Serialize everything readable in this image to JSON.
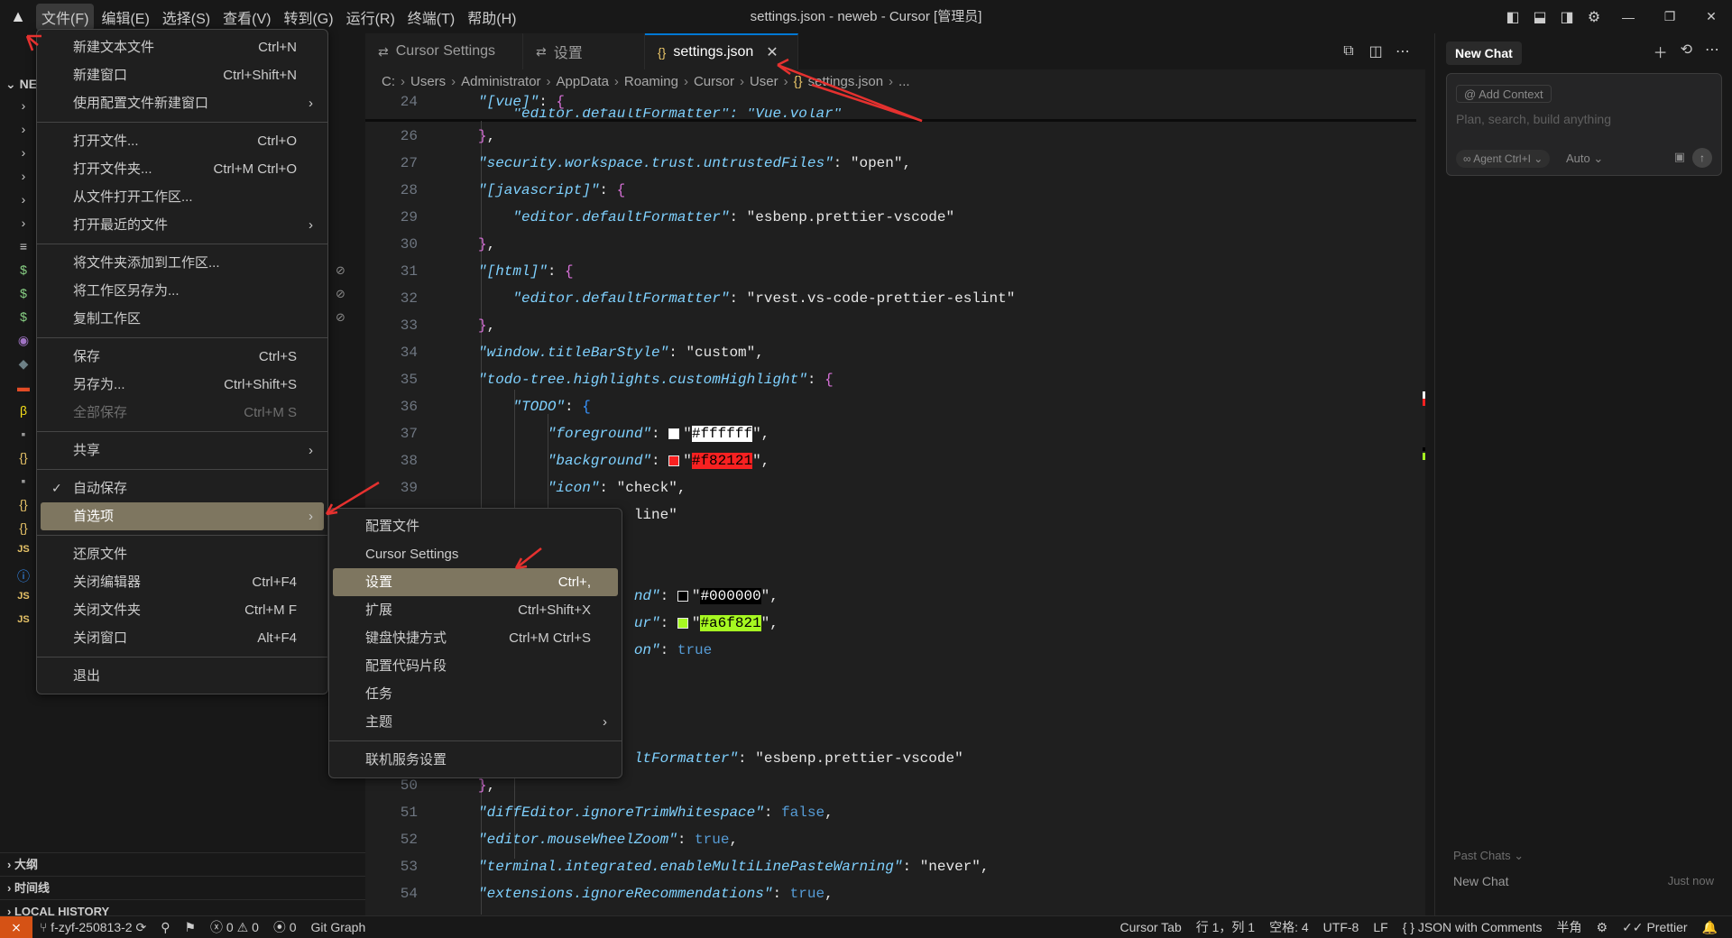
{
  "window_title": "settings.json - neweb - Cursor [管理员]",
  "menubar": [
    "文件(F)",
    "编辑(E)",
    "选择(S)",
    "查看(V)",
    "转到(G)",
    "运行(R)",
    "终端(T)",
    "帮助(H)"
  ],
  "sidebar": {
    "header": "NE",
    "bottom": [
      "大纲",
      "时间线",
      "LOCAL HISTORY"
    ]
  },
  "tabs": [
    {
      "label": "Cursor Settings",
      "icon": "settings-sliders-icon"
    },
    {
      "label": "设置",
      "icon": "settings-sliders-icon"
    },
    {
      "label": "settings.json",
      "icon": "json-braces-icon"
    }
  ],
  "breadcrumb": [
    "C:",
    "Users",
    "Administrator",
    "AppData",
    "Roaming",
    "Cursor",
    "User",
    "settings.json",
    "..."
  ],
  "file_menu": [
    {
      "label": "新建文本文件",
      "shortcut": "Ctrl+N"
    },
    {
      "label": "新建窗口",
      "shortcut": "Ctrl+Shift+N"
    },
    {
      "label": "使用配置文件新建窗口",
      "submenu": true
    },
    {
      "sep": true
    },
    {
      "label": "打开文件...",
      "shortcut": "Ctrl+O"
    },
    {
      "label": "打开文件夹...",
      "shortcut": "Ctrl+M Ctrl+O"
    },
    {
      "label": "从文件打开工作区..."
    },
    {
      "label": "打开最近的文件",
      "submenu": true
    },
    {
      "sep": true
    },
    {
      "label": "将文件夹添加到工作区..."
    },
    {
      "label": "将工作区另存为..."
    },
    {
      "label": "复制工作区"
    },
    {
      "sep": true
    },
    {
      "label": "保存",
      "shortcut": "Ctrl+S"
    },
    {
      "label": "另存为...",
      "shortcut": "Ctrl+Shift+S"
    },
    {
      "label": "全部保存",
      "shortcut": "Ctrl+M S",
      "disabled": true
    },
    {
      "sep": true
    },
    {
      "label": "共享",
      "submenu": true
    },
    {
      "sep": true
    },
    {
      "label": "自动保存",
      "checked": true
    },
    {
      "label": "首选项",
      "submenu": true,
      "highlighted": true
    },
    {
      "sep": true
    },
    {
      "label": "还原文件"
    },
    {
      "label": "关闭编辑器",
      "shortcut": "Ctrl+F4"
    },
    {
      "label": "关闭文件夹",
      "shortcut": "Ctrl+M F"
    },
    {
      "label": "关闭窗口",
      "shortcut": "Alt+F4"
    },
    {
      "sep": true
    },
    {
      "label": "退出"
    }
  ],
  "pref_menu": [
    {
      "label": "配置文件"
    },
    {
      "label": "Cursor Settings"
    },
    {
      "label": "设置",
      "shortcut": "Ctrl+,",
      "highlighted": true
    },
    {
      "label": "扩展",
      "shortcut": "Ctrl+Shift+X"
    },
    {
      "label": "键盘快捷方式",
      "shortcut": "Ctrl+M Ctrl+S"
    },
    {
      "label": "配置代码片段"
    },
    {
      "label": "任务"
    },
    {
      "label": "主题",
      "submenu": true
    },
    {
      "sep": true
    },
    {
      "label": "联机服务设置"
    }
  ],
  "code_lines": [
    {
      "n": "24",
      "html": "<span class='k'>\"[vue]\"</span><span class='p'>: </span><span class='b2'>{</span>"
    },
    {
      "n": "26",
      "html": "<span class='b2'>}</span><span class='p'>,</span>"
    },
    {
      "n": "27",
      "html": "<span class='k'>\"security.workspace.trust.untrustedFiles\"</span><span class='p'>: \"open\",</span>"
    },
    {
      "n": "28",
      "html": "<span class='k'>\"[javascript]\"</span><span class='p'>: </span><span class='b2'>{</span>"
    },
    {
      "n": "29",
      "html": "    <span class='k'>\"editor.defaultFormatter\"</span><span class='p'>: \"esbenp.prettier-vscode\"</span>"
    },
    {
      "n": "30",
      "html": "<span class='b2'>}</span><span class='p'>,</span>"
    },
    {
      "n": "31",
      "html": "<span class='k'>\"[html]\"</span><span class='p'>: </span><span class='b2'>{</span>"
    },
    {
      "n": "32",
      "html": "    <span class='k'>\"editor.defaultFormatter\"</span><span class='p'>: \"rvest.vs-code-prettier-eslint\"</span>"
    },
    {
      "n": "33",
      "html": "<span class='b2'>}</span><span class='p'>,</span>"
    },
    {
      "n": "34",
      "html": "<span class='k'>\"window.titleBarStyle\"</span><span class='p'>: \"custom\",</span>"
    },
    {
      "n": "35",
      "html": "<span class='k'>\"todo-tree.highlights.customHighlight\"</span><span class='p'>: </span><span class='b2'>{</span>"
    },
    {
      "n": "36",
      "html": "    <span class='k'>\"TODO\"</span><span class='p'>: </span><span class='b3'>{</span>"
    },
    {
      "n": "37",
      "html": "        <span class='k'>\"foreground\"</span><span class='p'>: </span><span class='sw' style='background:#ffffff'></span><span class='p'>\"</span><span style='background:#ffffff;color:#000'>#ffffff</span><span class='p'>\",</span>"
    },
    {
      "n": "38",
      "html": "        <span class='k'>\"background\"</span><span class='p'>: </span><span class='sw' style='background:#f82121'></span><span class='p'>\"</span><span style='background:#f82121;color:#000'>#f82121</span><span class='p'>\",</span>"
    },
    {
      "n": "39",
      "html": "        <span class='k'>\"icon\"</span><span class='p'>: \"check\",</span>"
    },
    {
      "n": "",
      "html": "                  <span class='p'>line\"</span>"
    },
    {
      "n": "",
      "html": ""
    },
    {
      "n": "",
      "html": ""
    },
    {
      "n": "",
      "html": "                  <span class='k'>nd\"</span><span class='p'>: </span><span class='sw' style='background:#000000'></span><span class='p'>\"</span><span style='background:#000000;color:#ffffff'>#000000</span><span class='p'>\",</span>"
    },
    {
      "n": "",
      "html": "                  <span class='k'>ur\"</span><span class='p'>: </span><span class='sw' style='background:#a6f821'></span><span class='p'>\"</span><span style='background:#a6f821;color:#000'>#a6f821</span><span class='p'>\",</span>"
    },
    {
      "n": "",
      "html": "                  <span class='k'>on\"</span><span class='p'>: </span><span class='bool'>true</span>"
    },
    {
      "n": "",
      "html": ""
    },
    {
      "n": "",
      "html": ""
    },
    {
      "n": "",
      "html": ""
    },
    {
      "n": "",
      "html": "                  <span class='k'>ltFormatter\"</span><span class='p'>: \"esbenp.prettier-vscode\"</span>"
    },
    {
      "n": "50",
      "html": "<span class='b2'>}</span><span class='p'>,</span>"
    },
    {
      "n": "51",
      "html": "<span class='k'>\"diffEditor.ignoreTrimWhitespace\"</span><span class='p'>: </span><span class='bool'>false</span><span class='p'>,</span>"
    },
    {
      "n": "52",
      "html": "<span class='k'>\"editor.mouseWheelZoom\"</span><span class='p'>: </span><span class='bool'>true</span><span class='p'>,</span>"
    },
    {
      "n": "53",
      "html": "<span class='k'>\"terminal.integrated.enableMultiLinePasteWarning\"</span><span class='p'>: \"never\",</span>"
    },
    {
      "n": "54",
      "html": "<span class='k'>\"extensions.ignoreRecommendations\"</span><span class='p'>: </span><span class='bool'>true</span><span class='p'>,</span>"
    }
  ],
  "partial_line_25": "\"editor.defaultFormatter\": \"Vue.volar\"",
  "chat": {
    "tab": "New Chat",
    "add_context": "Add Context",
    "placeholder": "Plan, search, build anything",
    "agent": "Agent Ctrl+I",
    "model": "Auto",
    "past_label": "Past Chats",
    "past_item": "New Chat",
    "past_time": "Just now"
  },
  "status": {
    "branch": "f-zyf-250813-2",
    "errors": "0",
    "warnings": "0",
    "ports": "0",
    "git_graph": "Git Graph",
    "right": [
      "Cursor Tab",
      "行 1，列 1",
      "空格: 4",
      "UTF-8",
      "LF",
      "{ } JSON with Comments",
      "半角",
      "Prettier"
    ]
  }
}
